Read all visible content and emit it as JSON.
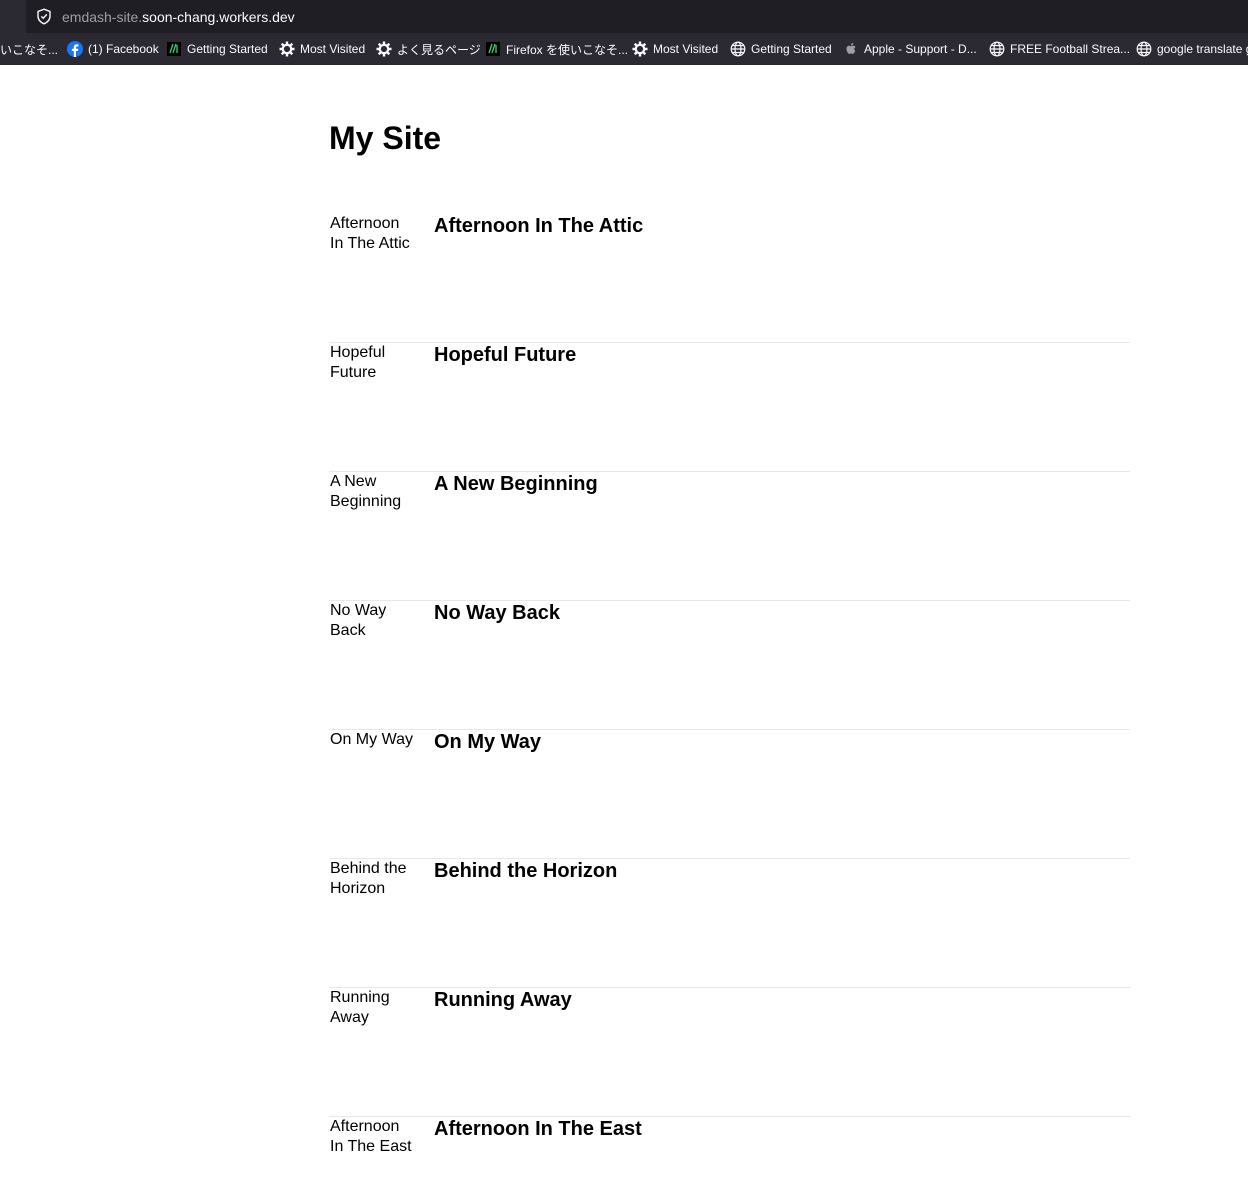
{
  "browser": {
    "url_subdomain": "emdash-site.",
    "url_domain": "soon-chang.workers.dev",
    "bookmarks": [
      {
        "label": "いこなそ...",
        "icon": "none"
      },
      {
        "label": "(1) Facebook",
        "icon": "facebook-icon"
      },
      {
        "label": "Getting Started",
        "icon": "mdn-icon"
      },
      {
        "label": "Most Visited",
        "icon": "gear-icon"
      },
      {
        "label": "よく見るページ",
        "icon": "gear-icon"
      },
      {
        "label": "Firefox を使いこなそ...",
        "icon": "mdn-icon"
      },
      {
        "label": "Most Visited",
        "icon": "gear-icon"
      },
      {
        "label": "Getting Started",
        "icon": "globe-icon"
      },
      {
        "label": "Apple - Support - D...",
        "icon": "apple-icon"
      },
      {
        "label": "FREE Football Strea...",
        "icon": "globe-icon"
      },
      {
        "label": "google translate g",
        "icon": "globe-icon"
      }
    ]
  },
  "site": {
    "title": "My Site"
  },
  "posts": [
    {
      "excerpt": "Afternoon In The Attic",
      "title": "Afternoon In The Attic"
    },
    {
      "excerpt": "Hopeful Future",
      "title": "Hopeful Future"
    },
    {
      "excerpt": "A New Beginning",
      "title": "A New Beginning"
    },
    {
      "excerpt": "No Way Back",
      "title": "No Way Back"
    },
    {
      "excerpt": "On My Way",
      "title": "On My Way"
    },
    {
      "excerpt": "Behind the Horizon",
      "title": "Behind the Horizon"
    },
    {
      "excerpt": "Running Away",
      "title": "Running Away"
    },
    {
      "excerpt": "Afternoon In The East",
      "title": "Afternoon In The East"
    }
  ]
}
